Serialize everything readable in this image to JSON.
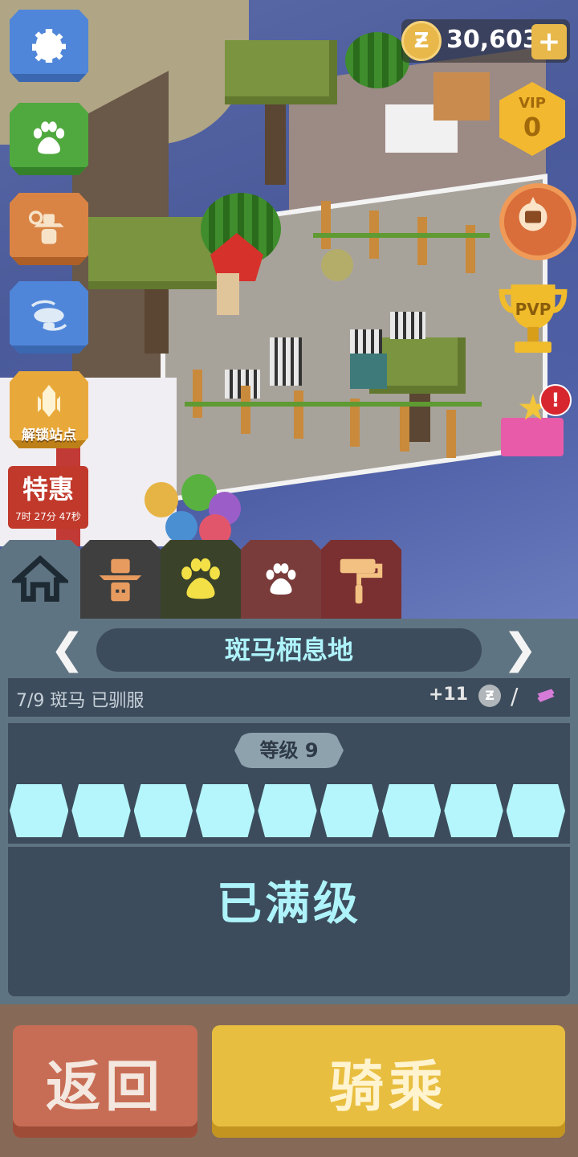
{
  "currency": {
    "coin_symbol": "Ƶ",
    "amount": "30,603",
    "plus": "+"
  },
  "vip": {
    "label": "VIP",
    "level": "0"
  },
  "pvp": {
    "label": "PVP"
  },
  "gift_badge": "!",
  "left_menu": {
    "unlock_label": "解锁站点",
    "sale": {
      "title": "特惠",
      "timer": "7时 27分 47秒"
    }
  },
  "habitat": {
    "name": "斑马栖息地",
    "prev_arrow": "❮",
    "next_arrow": "❯",
    "tamed_text": "7/9 斑马 已驯服",
    "reward": "+11",
    "reward_coin": "Ƶ",
    "separator": "/",
    "level_label": "等级 9",
    "level_progress_segments": 9,
    "level_segments_filled": 9,
    "status": "已满级"
  },
  "buttons": {
    "back": "返回",
    "ride": "骑乘"
  },
  "colors": {
    "accent_cyan": "#aef3fa",
    "ride_button": "#e8be40",
    "back_button": "#c86d55"
  }
}
